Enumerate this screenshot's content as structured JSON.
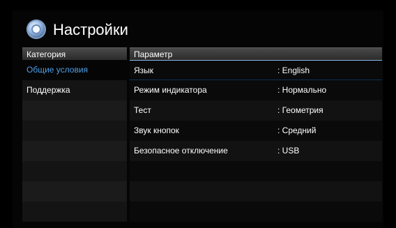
{
  "header": {
    "title": "Настройки"
  },
  "category": {
    "heading": "Категория",
    "items": [
      {
        "label": "Общие условия",
        "active": true
      },
      {
        "label": "Поддержка",
        "active": false
      }
    ]
  },
  "parameter": {
    "heading": "Параметр",
    "items": [
      {
        "label": "Язык",
        "value": ": English"
      },
      {
        "label": "Режим индикатора",
        "value": ": Нормально"
      },
      {
        "label": "Тест",
        "value": ": Геометрия"
      },
      {
        "label": "Звук кнопок",
        "value": ": Средний"
      },
      {
        "label": "Безопасное отключение",
        "value": ": USB"
      }
    ]
  },
  "colors": {
    "accent": "#4f9fe8",
    "selection": "#1f5fb0"
  }
}
